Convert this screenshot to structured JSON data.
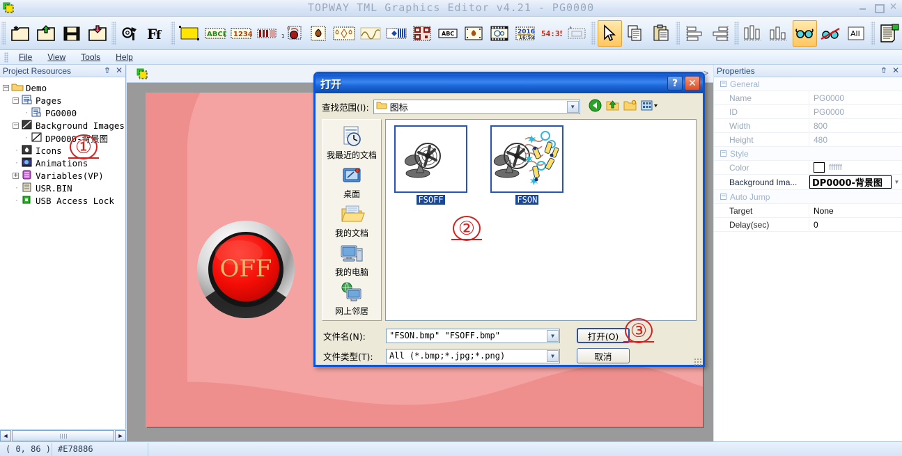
{
  "window": {
    "title": "TOPWAY TML Graphics Editor v4.21 - PG0000",
    "minimize": "minimize-button",
    "maximize": "maximize-button",
    "close": "close-button"
  },
  "menu": {
    "items": [
      {
        "label": "File"
      },
      {
        "label": "View"
      },
      {
        "label": "Tools"
      },
      {
        "label": "Help"
      }
    ]
  },
  "toolbar": {
    "groups": [
      {
        "items": [
          {
            "name": "new-file-icon",
            "tip": "New"
          },
          {
            "name": "open-file-icon",
            "tip": "Open"
          },
          {
            "name": "save-icon",
            "tip": "Save"
          },
          {
            "name": "import-icon",
            "tip": "Import"
          }
        ]
      },
      {
        "items": [
          {
            "name": "settings-tools-icon",
            "tip": "Configure"
          },
          {
            "name": "font-icon",
            "tip": "Font"
          }
        ]
      },
      {
        "items": [
          {
            "name": "rectangle-shape-icon",
            "tip": "Rectangle"
          },
          {
            "name": "ascii-text-icon",
            "tip": "ABCD"
          },
          {
            "name": "number-display-icon",
            "tip": "1234"
          },
          {
            "name": "bargraph-icon",
            "tip": "Bar Graph"
          },
          {
            "name": "button-icon",
            "tip": "Button"
          },
          {
            "name": "icon-object-icon",
            "tip": "Icon"
          },
          {
            "name": "multi-icon-icon",
            "tip": "Icon Group"
          },
          {
            "name": "curve-icon",
            "tip": "Curve"
          },
          {
            "name": "slider-icon",
            "tip": "Slider"
          },
          {
            "name": "qrcode-icon",
            "tip": "QR Code"
          },
          {
            "name": "label-text-icon",
            "tip": "ABC"
          },
          {
            "name": "picture-icon",
            "tip": "Picture"
          },
          {
            "name": "animation-icon",
            "tip": "Animation"
          },
          {
            "name": "clock-icon",
            "tip": "Clock 2016 16:59"
          },
          {
            "name": "timer-icon",
            "tip": "Timer 54:35"
          },
          {
            "name": "touch-area-icon",
            "tip": "Touch Area"
          }
        ]
      },
      {
        "items": [
          {
            "name": "select-arrow-icon",
            "tip": "Select",
            "active": true
          },
          {
            "name": "copy-icon",
            "tip": "Copy"
          },
          {
            "name": "paste-icon",
            "tip": "Paste"
          },
          {
            "name": "align-left-icon",
            "tip": "Align Left"
          },
          {
            "name": "align-right-icon",
            "tip": "Align Right"
          },
          {
            "name": "distribute-h-icon",
            "tip": "Distribute Horizontally"
          },
          {
            "name": "align-bottom-icon",
            "tip": "Align Bottom"
          },
          {
            "name": "show-preview-icon",
            "tip": "Show",
            "active": true
          },
          {
            "name": "hide-preview-icon",
            "tip": "Hide"
          },
          {
            "name": "all-icon",
            "label": "All",
            "tip": "All"
          }
        ]
      },
      {
        "items": [
          {
            "name": "compile-icon",
            "tip": "Compile"
          }
        ]
      }
    ]
  },
  "project_panel": {
    "title": "Project Resources",
    "pin": "pin-icon",
    "close": "close-icon",
    "tree": [
      {
        "label": "Demo",
        "icon": "folder-icon",
        "level": 0,
        "expander": "-"
      },
      {
        "label": "Pages",
        "icon": "pages-icon",
        "level": 1,
        "expander": "-"
      },
      {
        "label": "PG0000",
        "icon": "page-icon",
        "level": 2,
        "expander": ""
      },
      {
        "label": "Background Images",
        "icon": "background-images-icon",
        "level": 1,
        "expander": "-"
      },
      {
        "label": "DP0000-背景图",
        "icon": "background-image-icon",
        "level": 2,
        "expander": ""
      },
      {
        "label": "Icons",
        "icon": "icons-icon",
        "level": 1,
        "expander": ""
      },
      {
        "label": "Animations",
        "icon": "animations-icon",
        "level": 1,
        "expander": ""
      },
      {
        "label": "Variables(VP)",
        "icon": "variables-icon",
        "level": 1,
        "expander": "+"
      },
      {
        "label": "USR.BIN",
        "icon": "usrbin-icon",
        "level": 1,
        "expander": ""
      },
      {
        "label": "USB Access Lock",
        "icon": "usb-lock-icon",
        "level": 1,
        "expander": ""
      }
    ]
  },
  "canvas": {
    "page_icon": "page-doc-icon",
    "overflow_arrow": ">",
    "screen_button_label": "OFF",
    "bg_color": "#ee8f8d",
    "blob_color": "#f4a3a2"
  },
  "properties_panel": {
    "title": "Properties",
    "pin": "pin-icon",
    "close": "close-icon",
    "groups": [
      {
        "name": "General",
        "rows": [
          {
            "key": "Name",
            "value": "PG0000"
          },
          {
            "key": "ID",
            "value": "PG0000"
          },
          {
            "key": "Width",
            "value": "800"
          },
          {
            "key": "Height",
            "value": "480"
          }
        ]
      },
      {
        "name": "Style",
        "rows": [
          {
            "key": "Color",
            "value": "ffffff",
            "type": "color",
            "swatch": "#ffffff"
          },
          {
            "key": "Background Ima...",
            "value": "DP0000-背景图",
            "type": "combo"
          }
        ]
      },
      {
        "name": "Auto Jump",
        "rows": [
          {
            "key": "Target",
            "value": "None",
            "active": true
          },
          {
            "key": "Delay(sec)",
            "value": "0",
            "active": true
          }
        ]
      }
    ]
  },
  "statusbar": {
    "coordinates": "( 0, 86 )",
    "color_value": "#E78886"
  },
  "open_dialog": {
    "title": "打开",
    "help_button": "?",
    "close_button": "✕",
    "lookin_label": "查找范围(I):",
    "lookin_value": "图标",
    "nav_icons": [
      {
        "name": "back-icon"
      },
      {
        "name": "up-one-level-icon"
      },
      {
        "name": "new-folder-icon"
      },
      {
        "name": "views-icon"
      }
    ],
    "places": [
      {
        "label": "我最近的文档",
        "icon": "recent-documents-icon"
      },
      {
        "label": "桌面",
        "icon": "desktop-icon"
      },
      {
        "label": "我的文档",
        "icon": "my-documents-icon"
      },
      {
        "label": "我的电脑",
        "icon": "my-computer-icon"
      },
      {
        "label": "网上邻居",
        "icon": "network-places-icon"
      }
    ],
    "files": [
      {
        "name": "FSOFF",
        "icon": "fan-off-thumbnail",
        "selected": true
      },
      {
        "name": "FSON",
        "icon": "fan-on-thumbnail",
        "selected": true
      }
    ],
    "filename_label": "文件名(N):",
    "filename_value": "\"FSON.bmp\" \"FSOFF.bmp\"",
    "filetype_label": "文件类型(T):",
    "filetype_value": "All  (*.bmp;*.jpg;*.png)",
    "open_button": "打开(O)",
    "cancel_button": "取消"
  },
  "annotations": [
    {
      "number": "①",
      "target": "project-tree-icons-node"
    },
    {
      "number": "②",
      "target": "file-list-selection"
    },
    {
      "number": "③",
      "target": "open-button"
    }
  ]
}
